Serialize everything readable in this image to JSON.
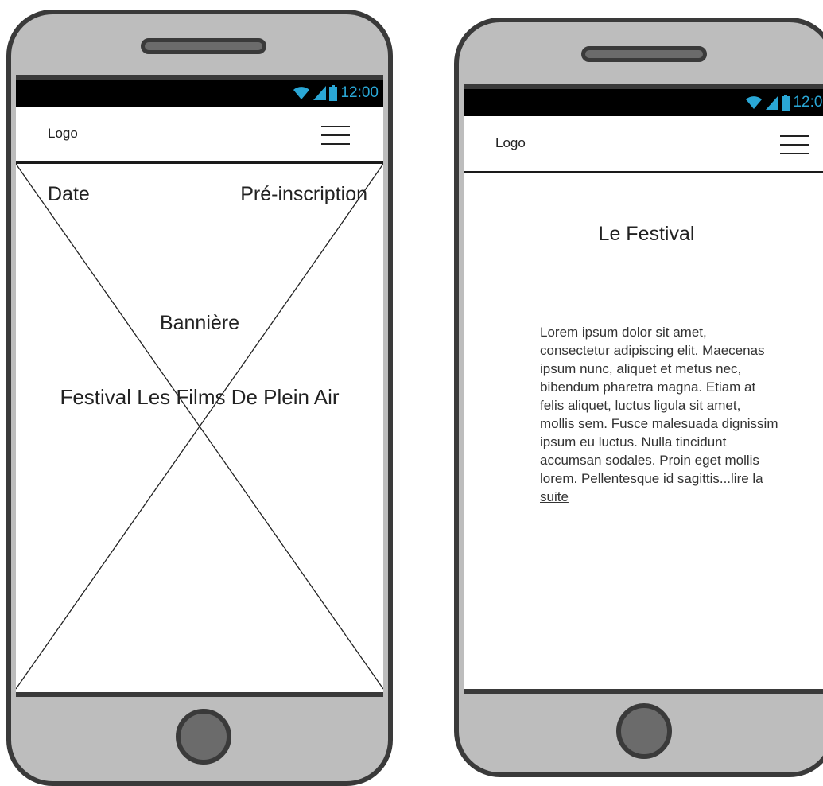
{
  "status_bar": {
    "time": "12:00"
  },
  "header": {
    "logo": "Logo"
  },
  "left_phone": {
    "banner": {
      "date": "Date",
      "preinscription": "Pré-inscription",
      "label": "Bannière",
      "title": "Festival Les Films De Plein Air"
    }
  },
  "right_phone": {
    "section": {
      "title": "Le Festival",
      "body": "Lorem ipsum dolor sit amet, consectetur adipiscing elit. Maecenas ipsum nunc, aliquet et metus nec, bibendum pharetra magna. Etiam at felis aliquet, luctus ligula sit amet, mollis sem. Fusce malesuada dignissim ipsum eu luctus. Nulla tincidunt accumsan sodales. Proin eget mollis lorem. Pellentesque id sagittis...",
      "read_more": "lire la suite"
    }
  },
  "colors": {
    "phone_body": "#bdbdbd",
    "phone_frame": "#3a3a3a",
    "status_icons": "#2aa7d6"
  }
}
